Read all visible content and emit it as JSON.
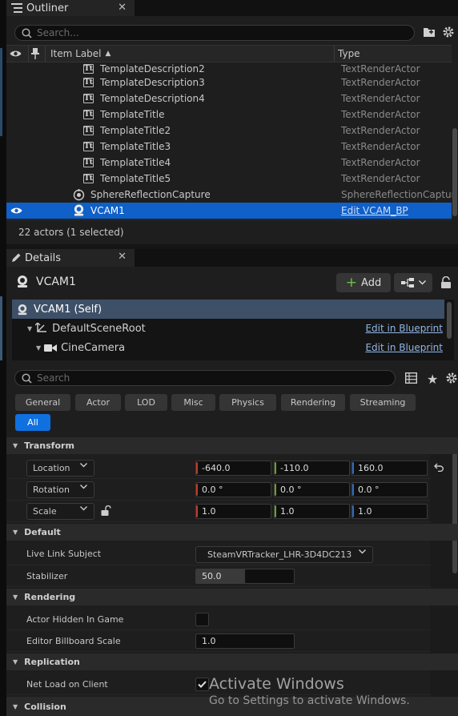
{
  "outliner": {
    "tab_title": "Outliner",
    "search_placeholder": "Search...",
    "columns": {
      "item_label": "Item Label",
      "type": "Type"
    },
    "rows": [
      {
        "name": "TemplateDescription2",
        "type": "TextRenderActor",
        "icon": "text-render-icon"
      },
      {
        "name": "TemplateDescription3",
        "type": "TextRenderActor",
        "icon": "text-render-icon"
      },
      {
        "name": "TemplateDescription4",
        "type": "TextRenderActor",
        "icon": "text-render-icon"
      },
      {
        "name": "TemplateTitle",
        "type": "TextRenderActor",
        "icon": "text-render-icon"
      },
      {
        "name": "TemplateTitle2",
        "type": "TextRenderActor",
        "icon": "text-render-icon"
      },
      {
        "name": "TemplateTitle3",
        "type": "TextRenderActor",
        "icon": "text-render-icon"
      },
      {
        "name": "TemplateTitle4",
        "type": "TextRenderActor",
        "icon": "text-render-icon"
      },
      {
        "name": "TemplateTitle5",
        "type": "TextRenderActor",
        "icon": "text-render-icon"
      },
      {
        "name": "SphereReflectionCapture",
        "type": "SphereReflectionCaptur",
        "icon": "reflection-capture-icon"
      },
      {
        "name": "VCAM1",
        "type": "Edit VCAM_BP",
        "icon": "camera-actor-icon",
        "selected": true
      }
    ],
    "footer": "22 actors (1 selected)"
  },
  "details": {
    "tab_title": "Details",
    "actor_name": "VCAM1",
    "add_label": "Add",
    "components": [
      {
        "name": "VCAM1 (Self)",
        "selected": true
      },
      {
        "name": "DefaultSceneRoot",
        "link": "Edit in Blueprint"
      },
      {
        "name": "CineCamera",
        "link": "Edit in Blueprint"
      }
    ],
    "search_placeholder": "Search",
    "filters": [
      "General",
      "Actor",
      "LOD",
      "Misc",
      "Physics",
      "Rendering",
      "Streaming",
      "All"
    ],
    "active_filter": "All",
    "sections": {
      "transform": "Transform",
      "default": "Default",
      "rendering": "Rendering",
      "replication": "Replication",
      "collision": "Collision"
    },
    "transform": {
      "location": {
        "label": "Location",
        "x": "-640.0",
        "y": "-110.0",
        "z": "160.0"
      },
      "rotation": {
        "label": "Rotation",
        "x": "0.0 °",
        "y": "0.0 °",
        "z": "0.0 °"
      },
      "scale": {
        "label": "Scale",
        "x": "1.0",
        "y": "1.0",
        "z": "1.0"
      }
    },
    "default_props": {
      "live_link_label": "Live Link Subject",
      "live_link_value": "SteamVRTracker_LHR-3D4DC213",
      "stabilizer_label": "Stabilizer",
      "stabilizer_value": "50.0",
      "stabilizer_fill": 0.5
    },
    "rendering_props": {
      "hidden_label": "Actor Hidden In Game",
      "hidden_checked": false,
      "billboard_label": "Editor Billboard Scale",
      "billboard_value": "1.0"
    },
    "replication_props": {
      "net_load_label": "Net Load on Client",
      "net_load_checked": true
    }
  },
  "watermark": {
    "title": "Activate Windows",
    "subtitle": "Go to Settings to activate Windows."
  },
  "colors": {
    "selection_blue": "#0f60c8",
    "active_filter": "#0f70e0",
    "link": "#8fb6e6"
  }
}
